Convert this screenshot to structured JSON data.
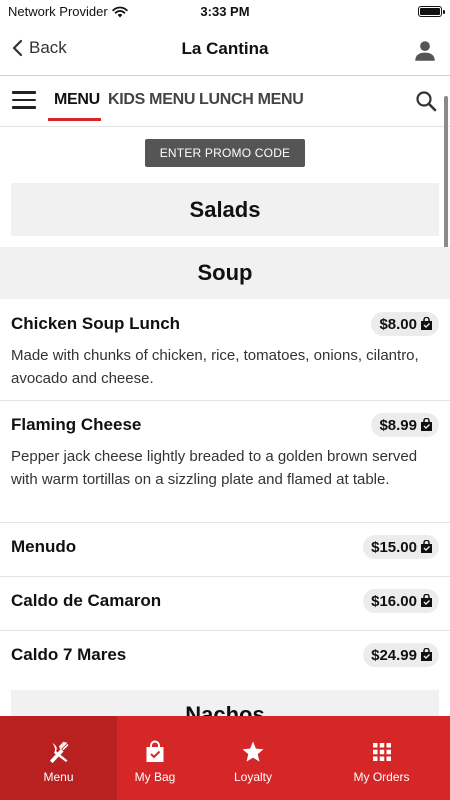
{
  "status_bar": {
    "carrier": "Network Provider",
    "time": "3:33 PM"
  },
  "header": {
    "back_label": "Back",
    "title": "La Cantina"
  },
  "tabs": [
    {
      "label": "MENU",
      "active": true
    },
    {
      "label": "KIDS MENU",
      "active": false
    },
    {
      "label": "LUNCH MENU",
      "active": false
    }
  ],
  "promo": {
    "label": "ENTER PROMO CODE"
  },
  "categories": {
    "salads": "Salads",
    "soup": "Soup",
    "nachos": "Nachos"
  },
  "items": [
    {
      "name": "Chicken Soup Lunch",
      "price": "$8.00",
      "description": "Made with chunks of chicken, rice, tomatoes, onions, cilantro, avocado and cheese."
    },
    {
      "name": "Flaming Cheese",
      "price": "$8.99",
      "description": "Pepper jack cheese lightly breaded to a golden brown served with warm tortillas on a sizzling plate and flamed at table."
    },
    {
      "name": "Menudo",
      "price": "$15.00",
      "description": ""
    },
    {
      "name": "Caldo de Camaron",
      "price": "$16.00",
      "description": ""
    },
    {
      "name": "Caldo 7 Mares",
      "price": "$24.99",
      "description": ""
    }
  ],
  "bottom_nav": [
    {
      "label": "Menu",
      "icon": "utensils-icon",
      "active": true
    },
    {
      "label": "My Bag",
      "icon": "bag-icon",
      "active": false
    },
    {
      "label": "Loyalty",
      "icon": "star-icon",
      "active": false
    },
    {
      "label": "My Orders",
      "icon": "grid-icon",
      "active": false
    }
  ],
  "colors": {
    "accent": "#d62728",
    "accent_active": "#b92121",
    "promo_bg": "#555555",
    "category_bg": "#f1f1f1"
  }
}
